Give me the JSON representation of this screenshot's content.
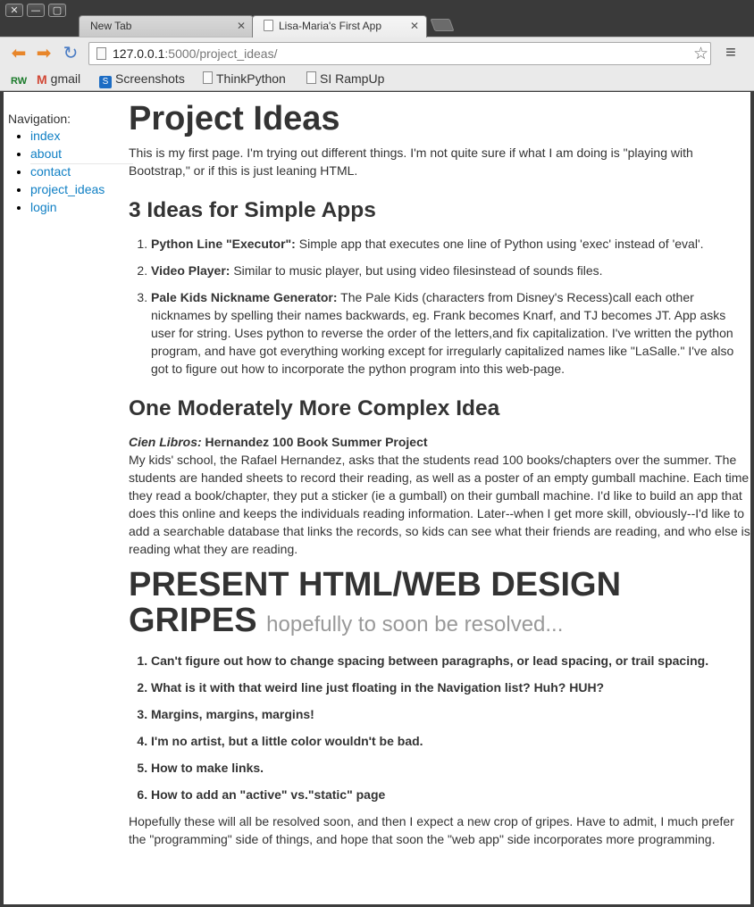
{
  "browser": {
    "tabs": [
      {
        "label": "New Tab"
      },
      {
        "label": "Lisa-Maria's First App"
      }
    ],
    "window_buttons": [
      "✕",
      "—",
      "▢"
    ],
    "url_host": "127.0.0.1",
    "url_rest": ":5000/project_ideas/",
    "bookmarks": [
      {
        "label": "",
        "icon": "rw-icon"
      },
      {
        "label": "gmail",
        "icon": "gmail-icon"
      },
      {
        "label": "Screenshots",
        "icon": "screenshots-icon"
      },
      {
        "label": "ThinkPython",
        "icon": "page-icon"
      },
      {
        "label": "SI RampUp",
        "icon": "page-icon"
      }
    ]
  },
  "sidebar": {
    "label": "Navigation:",
    "items": [
      "index",
      "about",
      "contact",
      "project_ideas",
      "login"
    ]
  },
  "main": {
    "title": "Project Ideas",
    "intro": "This is my first page. I'm trying out different things. I'm not quite sure if what I am doing is \"playing with Bootstrap,\" or if this is just leaning HTML.",
    "simple_heading": "3 Ideas for Simple Apps",
    "simple_ideas": [
      {
        "name": "Python Line \"Executor\":",
        "text": " Simple app that executes one line of Python using 'exec' instead of 'eval'."
      },
      {
        "name": "Video Player:",
        "text": " Similar to music player, but using video filesinstead of sounds files."
      },
      {
        "name": "Pale Kids Nickname Generator:",
        "text": " The Pale Kids (characters from Disney's Recess)call each other nicknames by spelling their names backwards, eg. Frank becomes Knarf, and TJ becomes JT. App asks user for string. Uses python to reverse the order of the letters,and fix capitalization. I've written the python program, and have got everything working except for irregularly capitalized names like \"LaSalle.\" I've also got to figure out how to incorporate the python program into this web-page."
      }
    ],
    "complex_heading": "One Moderately More Complex Idea",
    "complex_italic": "Cien Libros:",
    "complex_bold": " Hernandez 100 Book Summer Project",
    "complex_text": "My kids' school, the Rafael Hernandez, asks that the students read 100 books/chapters over the summer. The students are handed sheets to record their reading, as well as a poster of an empty gumball machine. Each time they read a book/chapter, they put a sticker (ie a gumball) on their gumball machine. I'd like to build an app that does this online and keeps the individuals reading information. Later--when I get more skill, obviously--I'd like to add a searchable database that links the records, so kids can see what their friends are reading, and who else is reading what they are reading.",
    "gripes_heading": "PRESENT HTML/WEB DESIGN GRIPES",
    "gripes_sub": "hopefully to soon be resolved...",
    "gripes": [
      "Can't figure out how to change spacing between paragraphs, or lead spacing, or trail spacing.",
      "What is it with that weird line just floating in the Navigation list? Huh? HUH?",
      "Margins, margins, margins!",
      "I'm no artist, but a little color wouldn't be bad.",
      "How to make links.",
      "How to add an \"active\" vs.\"static\" page"
    ],
    "closing": "Hopefully these will all be resolved soon, and then I expect a new crop of gripes. Have to admit, I much prefer the \"programming\" side of things, and hope that soon the \"web app\" side incorporates more programming."
  }
}
